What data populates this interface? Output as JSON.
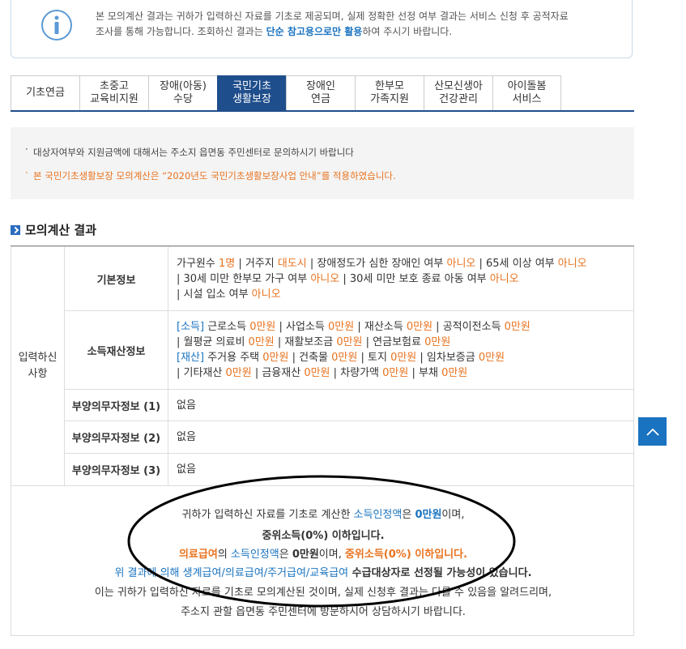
{
  "notice": {
    "line1": "본 모의계산 결과는 귀하가 입력하신 자료를 기초로 제공되며, 실제 정확한 선정 여부 결과는 서비스 신청 후 공적자료",
    "line2_pre": "조사를 통해 가능합니다. 조회하신 결과는 ",
    "line2_em": "단순 참고용으로만 활용",
    "line2_post": "하여 주시기 바랍니다."
  },
  "tabs": [
    {
      "label": "기초연금",
      "active": false
    },
    {
      "label": "초중고\n교육비지원",
      "active": false
    },
    {
      "label": "장애(아동)\n수당",
      "active": false
    },
    {
      "label": "국민기초\n생활보장",
      "active": true
    },
    {
      "label": "장애인\n연금",
      "active": false
    },
    {
      "label": "한부모\n가족지원",
      "active": false
    },
    {
      "label": "산모신생아\n건강관리",
      "active": false
    },
    {
      "label": "아이돌봄\n서비스",
      "active": false
    }
  ],
  "info": {
    "line1": "대상자여부와 지원금액에 대해서는 주소지 읍면동 주민센터로 문의하시기 바랍니다",
    "line2": "본 국민기초생활보장 모의계산은 “2020년도 국민기초생활보장사업 안내”를 적용하였습니다."
  },
  "section_title": "모의계산 결과",
  "table": {
    "row_header": "입력하신\n사항",
    "basic_label": "기본정보",
    "basic": {
      "hh_label": "가구원수 ",
      "hh_val": "1명",
      "res_label": " | 거주지 ",
      "res_val": "대도시",
      "dis_label": " | 장애정도가 심한 장애인 여부 ",
      "dis_val": "아니오",
      "age65_label": " | 65세 이상 여부 ",
      "age65_val": "아니오",
      "single_label": "| 30세 미만 한부모 가구 여부 ",
      "single_val": "아니오",
      "prot_label": " | 30세 미만 보호 종료 아동 여부 ",
      "prot_val": "아니오",
      "fac_label": "| 시설 입소 여부 ",
      "fac_val": "아니오"
    },
    "income_label": "소득재산정보",
    "income": {
      "tag_income": "[소득]",
      "work": " 근로소득 ",
      "work_val": "0만원",
      "biz": " | 사업소득 ",
      "biz_val": "0만원",
      "prop": " | 재산소득 ",
      "prop_val": "0만원",
      "pub": " | 공적이전소득 ",
      "pub_val": "0만원",
      "med": "| 월평균 의료비 ",
      "med_val": "0만원",
      "disaster": " | 재활보조금 ",
      "disaster_val": "0만원",
      "pension": " | 연금보험료 ",
      "pension_val": "0만원",
      "tag_asset": "[재산]",
      "house": " 주거용 주택 ",
      "house_val": "0만원",
      "bldg": " | 건축물 ",
      "bldg_val": "0만원",
      "land": " | 토지 ",
      "land_val": "0만원",
      "deposit": " | 임차보증금 ",
      "deposit_val": "0만원",
      "other": "| 기타재산 ",
      "other_val": "0만원",
      "fin": " | 금융재산 ",
      "fin_val": "0만원",
      "car": " | 차량가액 ",
      "car_val": "0만원",
      "debt": " | 부채 ",
      "debt_val": "0만원"
    },
    "dep1_label": "부양의무자정보 (1)",
    "dep1_val": "없음",
    "dep2_label": "부양의무자정보 (2)",
    "dep2_val": "없음",
    "dep3_label": "부양의무자정보 (3)",
    "dep3_val": "없음"
  },
  "summary": {
    "l1_pre": "귀하가 입력하신 자료를 기초로 계산한 ",
    "l1_em": "소득인정액",
    "l1_mid": "은 ",
    "l1_val": "0만원",
    "l1_post": "이며,",
    "l2": "중위소득(0%) 이하입니다.",
    "l3_a": "의료급여",
    "l3_b": "의 ",
    "l3_c": "소득인정액",
    "l3_d": "은 ",
    "l3_e": "0만원",
    "l3_f": "이며, ",
    "l3_g": "중위소득(0%) 이하입니다.",
    "l4_pre": "위 결과에 의해 ",
    "l4_em": "생계급여/의료급여/주거급여/교육급여",
    "l4_post": " 수급대상자로 선정될 가능성이 있습니다.",
    "l5": "이는 귀하가 입력하신 자료를 기초로 모의계산된 것이며, 실제 신청후 결과는 다를 수 있음을 알려드리며,",
    "l6": "주소지 관할 읍면동 주민센터에 방문하시어 상담하시기 바랍니다."
  },
  "colors": {
    "accent": "#1f4e8c",
    "orange": "#e8731f",
    "link_blue": "#1a73c0"
  },
  "icons": {
    "info": "info-circle-icon",
    "scroll_top": "chevron-up-icon"
  }
}
